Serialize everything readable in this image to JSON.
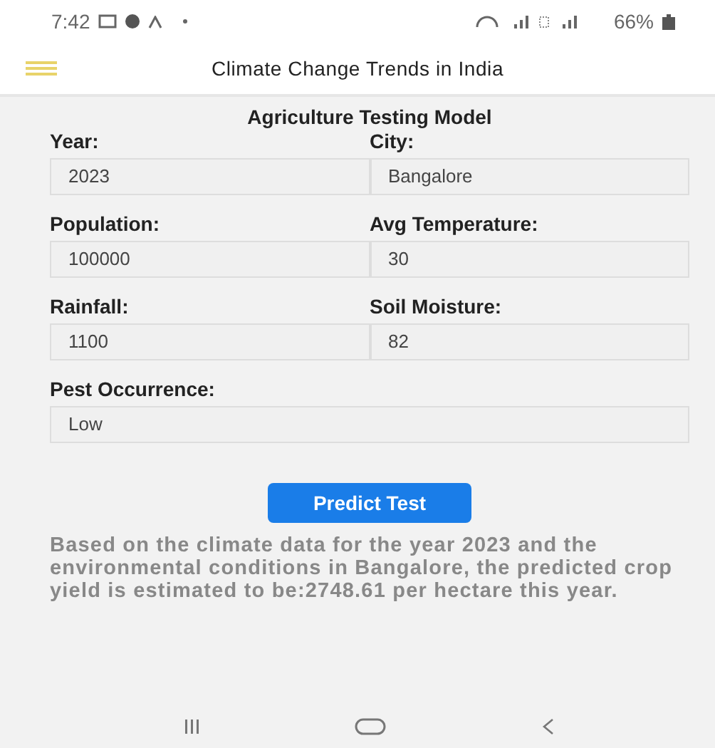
{
  "status_bar": {
    "time": "7:42",
    "battery": "66%"
  },
  "app_bar": {
    "title": "Climate Change Trends in India"
  },
  "form": {
    "title": "Agriculture Testing Model",
    "fields": [
      {
        "label": "Year:",
        "value": "2023",
        "wide": false
      },
      {
        "label": "City:",
        "value": "Bangalore",
        "wide": false
      },
      {
        "label": "Population:",
        "value": "100000",
        "wide": false
      },
      {
        "label": "Avg Temperature:",
        "value": "30",
        "wide": false
      },
      {
        "label": "Rainfall:",
        "value": "1100",
        "wide": false
      },
      {
        "label": "Soil Moisture:",
        "value": "82",
        "wide": false
      },
      {
        "label": "Pest Occurrence:",
        "value": "Low",
        "wide": true
      }
    ],
    "button": "Predict Test",
    "result": "Based on the climate data for the year 2023 and the environmental conditions in Bangalore, the predicted crop yield is estimated to be:2748.61 per hectare this year."
  }
}
